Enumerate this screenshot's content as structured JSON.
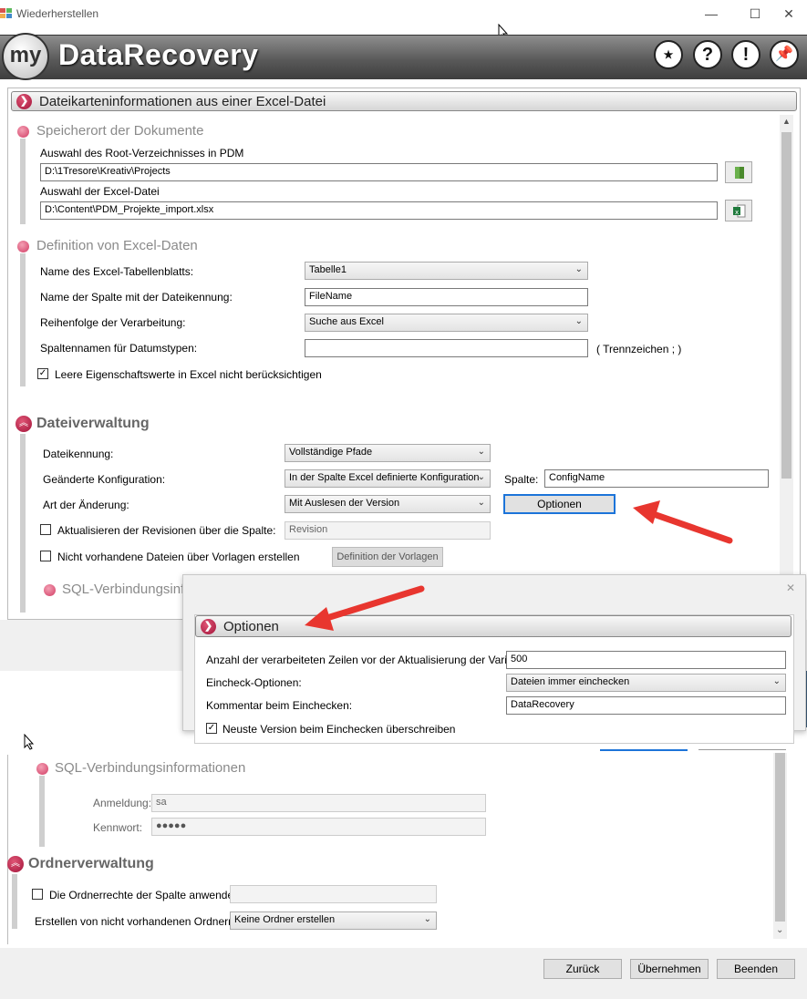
{
  "window": {
    "title": "Wiederherstellen",
    "minimize": "—",
    "maximize": "☐",
    "close": "✕"
  },
  "banner": {
    "logo_short": "my",
    "app_name": "DataRecovery",
    "buttons": [
      {
        "icon": "rating-stars-icon",
        "glyph": "★"
      },
      {
        "icon": "help-icon",
        "glyph": "?"
      },
      {
        "icon": "info-icon",
        "glyph": "!"
      },
      {
        "icon": "pin-icon",
        "glyph": "📌"
      }
    ]
  },
  "panel": {
    "header": "Dateikarteninformationen aus einer Excel-Datei",
    "storage": {
      "title": "Speicherort der Dokumente",
      "root_label": "Auswahl des Root-Verzeichnisses in PDM",
      "root_value": "D:\\1Tresore\\Kreativ\\Projects",
      "excel_label": "Auswahl der Excel-Datei",
      "excel_value": "D:\\Content\\PDM_Projekte_import.xlsx"
    },
    "excel_def": {
      "title": "Definition von Excel-Daten",
      "sheet_label": "Name des Excel-Tabellenblatts:",
      "sheet_value": "Tabelle1",
      "column_label": "Name der Spalte mit der Dateikennung:",
      "column_value": "FileName",
      "order_label": "Reihenfolge der Verarbeitung:",
      "order_value": "Suche aus Excel",
      "date_label": "Spaltennamen für Datumstypen:",
      "date_value": "",
      "date_hint": "( Trennzeichen ; )",
      "ignore_empty_label": "Leere Eigenschaftswerte in Excel nicht berücksichtigen",
      "ignore_empty_checked": true
    },
    "file_mgmt": {
      "title": "Dateiverwaltung",
      "id_label": "Dateikennung:",
      "id_value": "Vollständige Pfade",
      "config_label": "Geänderte Konfiguration:",
      "config_value": "In der Spalte Excel definierte Konfiguration",
      "column_label": "Spalte:",
      "column_value": "ConfigName",
      "change_label": "Art der Änderung:",
      "change_value": "Mit Auslesen der Version",
      "options_button": "Optionen",
      "revisions_label": "Aktualisieren der Revisionen über die Spalte:",
      "revisions_value": "Revision",
      "templates_label": "Nicht vorhandene Dateien über Vorlagen erstellen",
      "templates_button": "Definition der Vorlagen"
    },
    "sql_cut": "SQL-Verbindungsinf"
  },
  "dialog": {
    "header": "Optionen",
    "rows_label": "Anzahl der verarbeiteten Zeilen vor der Aktualisierung der Variablen:",
    "rows_value": "500",
    "checkin_label": "Eincheck-Optionen:",
    "checkin_value": "Dateien immer einchecken",
    "comment_label": "Kommentar beim Einchecken:",
    "comment_value": "DataRecovery",
    "overwrite_label": "Neuste Version beim Einchecken überschreiben",
    "overwrite_checked": true
  },
  "lower": {
    "sql": {
      "title": "SQL-Verbindungsinformationen",
      "login_label": "Anmeldung:",
      "login_value": "sa",
      "password_label": "Kennwort:",
      "password_value": "●●●●●"
    },
    "folders": {
      "title": "Ordnerverwaltung",
      "rights_label": "Die Ordnerrechte der Spalte anwenden",
      "rights_value": "",
      "create_label": "Erstellen von nicht vorhandenen Ordnern:",
      "create_value": "Keine Ordner erstellen"
    }
  },
  "footer": {
    "back": "Zurück",
    "apply": "Übernehmen",
    "exit": "Beenden"
  },
  "colors": {
    "accent": "#c0204a",
    "arrow": "#e8362f",
    "focus": "#1c74d9"
  }
}
